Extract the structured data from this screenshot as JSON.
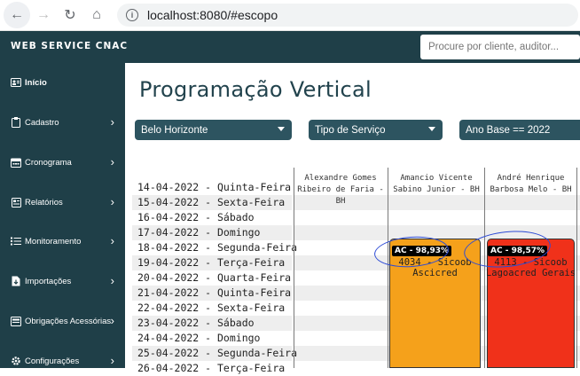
{
  "browser": {
    "url": "localhost:8080/#escopo",
    "back_icon": "←",
    "forward_icon": "→",
    "reload_icon": "↻",
    "home_icon": "⌂"
  },
  "header": {
    "brand": "WEB SERVICE CNAC",
    "search_placeholder": "Procure por cliente, auditor..."
  },
  "sidebar": {
    "items": [
      {
        "label": "Início",
        "icon": "id-card-icon",
        "active": true
      },
      {
        "label": "Cadastro",
        "icon": "clipboard-icon"
      },
      {
        "label": "Cronograma",
        "icon": "calendar-icon"
      },
      {
        "label": "Relatórios",
        "icon": "report-icon"
      },
      {
        "label": "Monitoramento",
        "icon": "list-icon"
      },
      {
        "label": "Importações",
        "icon": "import-icon"
      },
      {
        "label": "Obrigações Acessórias",
        "icon": "folder-icon"
      },
      {
        "label": "Configurações",
        "icon": "gear-icon"
      }
    ]
  },
  "main": {
    "title": "Programação Vertical",
    "filters": [
      "Belo Horizonte",
      "Tipo de Serviço",
      "Ano Base == 2022"
    ]
  },
  "schedule": {
    "dates": [
      "14-04-2022 - Quinta-Feira",
      "15-04-2022 - Sexta-Feira",
      "16-04-2022 - Sábado",
      "17-04-2022 - Domingo",
      "18-04-2022 - Segunda-Feira",
      "19-04-2022 - Terça-Feira",
      "20-04-2022 - Quarta-Feira",
      "21-04-2022 - Quinta-Feira",
      "22-04-2022 - Sexta-Feira",
      "23-04-2022 - Sábado",
      "24-04-2022 - Domingo",
      "25-04-2022 - Segunda-Feira",
      "26-04-2022 - Terça-Feira"
    ],
    "columns": [
      {
        "line1": "Alexandre Gomes",
        "line2": "Ribeiro de Faria -",
        "line3": "BH"
      },
      {
        "line1": "Amancio Vicente",
        "line2": "Sabino Junior - BH",
        "line3": ""
      },
      {
        "line1": "André Henrique",
        "line2": "Barbosa Melo - BH",
        "line3": ""
      }
    ],
    "bars": [
      {
        "badge": "AC - 98,93%",
        "line1": "4034 - Sicoob",
        "line2": "Ascicred",
        "color": "#f5a11b"
      },
      {
        "badge": "AC - 98,57%",
        "line1": "4113 - Sicoob",
        "line2": "Lagoacred Gerais",
        "color": "#f0311a"
      }
    ]
  }
}
